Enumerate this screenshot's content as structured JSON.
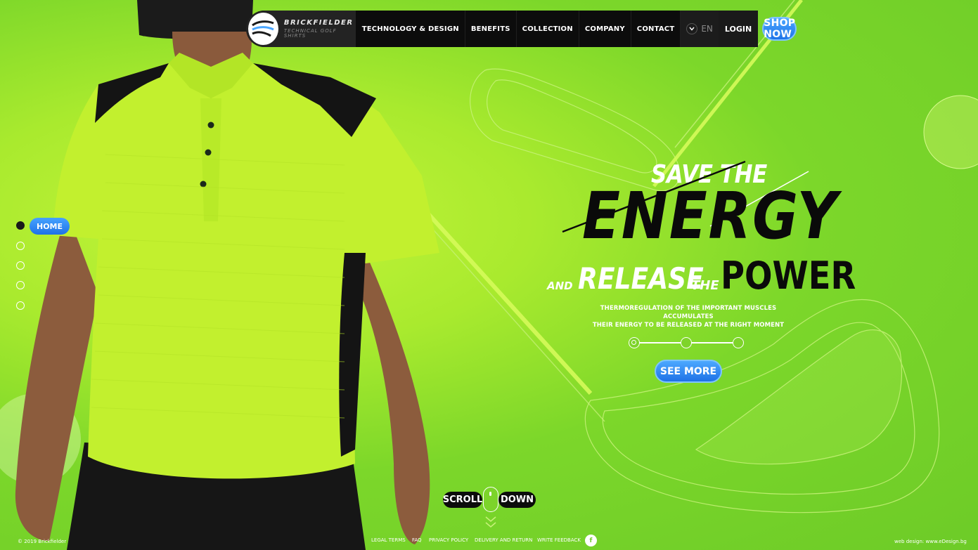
{
  "brand": {
    "name": "BRICKFIELDER",
    "tagline": "TECHNICAL GOLF SHIRTS"
  },
  "nav": {
    "items": [
      {
        "label": "TECHNOLOGY & DESIGN"
      },
      {
        "label": "BENEFITS"
      },
      {
        "label": "COLLECTION"
      },
      {
        "label": "COMPANY"
      },
      {
        "label": "CONTACT"
      }
    ],
    "language": "EN",
    "login": "LOGIN",
    "shop_now": "SHOP NOW"
  },
  "side_nav": {
    "active_label": "HOME"
  },
  "hero": {
    "line1": "SAVE THE",
    "line2": "ENERGY",
    "and": "AND",
    "release": "RELEASE",
    "the": "THE",
    "power": "POWER",
    "subtext_line1": "THERMOREGULATION OF THE IMPORTANT MUSCLES ACCUMULATES",
    "subtext_line2": "THEIR ENERGY TO BE RELEASED AT THE RIGHT MOMENT",
    "cta": "SEE MORE"
  },
  "scroll": {
    "left": "SCROLL",
    "right": "DOWN"
  },
  "footer": {
    "copyright": "© 2019 Brickfielder",
    "links": [
      "LEGAL TERMS",
      "FAQ",
      "PRIVACY POLICY",
      "DELIVERY AND RETURN",
      "WRITE FEEDBACK"
    ],
    "credit": "web design: www.eDesign.bg"
  },
  "colors": {
    "accent_blue": "#2b8cf5",
    "background_green": "#7cd72a",
    "shirt_lime": "#c2f02e",
    "nav_dark": "#0c0c0c"
  }
}
